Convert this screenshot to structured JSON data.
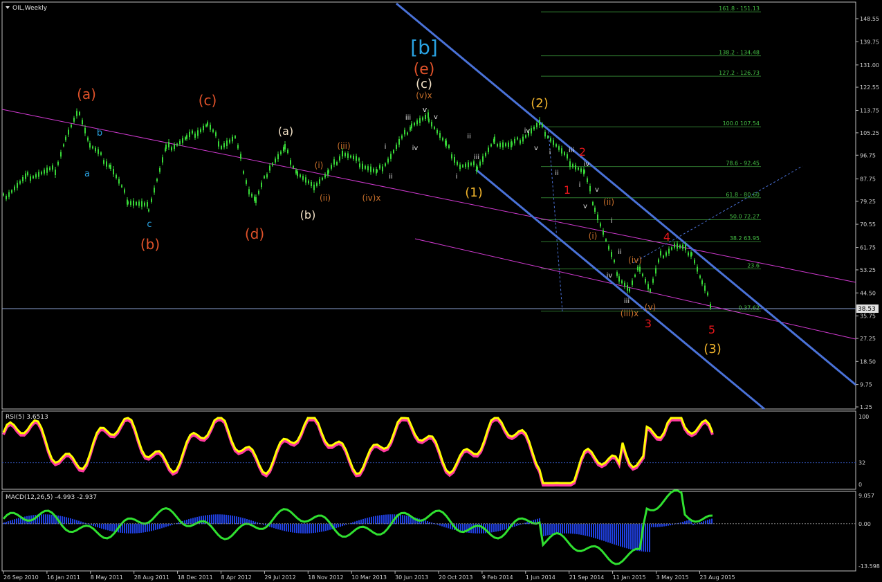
{
  "chart_data": [
    {
      "type": "candlestick",
      "title": "OIL,Weekly",
      "current_price": "38.53",
      "y_ticks": [
        "148.55",
        "139.75",
        "131.00",
        "122.55",
        "113.75",
        "105.25",
        "96.75",
        "87.75",
        "79.25",
        "70.55",
        "61.75",
        "53.25",
        "44.50",
        "35.75",
        "27.25",
        "18.50",
        "9.75",
        "1.25"
      ],
      "x_ticks": [
        "26 Sep 2010",
        "16 Jan 2011",
        "8 May 2011",
        "28 Aug 2011",
        "18 Dec 2011",
        "8 Apr 2012",
        "29 Jul 2012",
        "18 Nov 2012",
        "10 Mar 2013",
        "30 Jun 2013",
        "20 Oct 2013",
        "9 Feb 2014",
        "1 Jun 2014",
        "21 Sep 2014",
        "11 Jan 2015",
        "3 May 2015",
        "23 Aug 2015"
      ],
      "fib_levels": [
        {
          "label": "161.8 - 151.13",
          "value": 151.13
        },
        {
          "label": "138.2 - 134.48",
          "value": 134.48
        },
        {
          "label": "127.2 - 126.73",
          "value": 126.73
        },
        {
          "label": "100.0 107.54",
          "value": 107.54
        },
        {
          "label": "78.6 - 92.45",
          "value": 92.45
        },
        {
          "label": "61.8 - 80.60",
          "value": 80.6
        },
        {
          "label": "50.0 72.27",
          "value": 72.27
        },
        {
          "label": "38.2 63.95",
          "value": 63.95
        },
        {
          "label": "23.6",
          "value": 53.6
        },
        {
          "label": "0.37.62",
          "value": 37.62
        }
      ],
      "waves": [
        {
          "text": "[b]",
          "color": "#29a3e3",
          "size": 28
        },
        {
          "text": "(e)",
          "color": "#e0522a",
          "size": 22
        },
        {
          "text": "(c)",
          "color": "#f3e2c7",
          "size": 18
        },
        {
          "text": "(v)x",
          "color": "#c8702b",
          "size": 12
        },
        {
          "text": "v",
          "color": "#e0e0e0",
          "size": 11
        },
        {
          "text": "(a)",
          "color": "#e0522a",
          "size": 20
        },
        {
          "text": "(b)",
          "color": "#e0522a",
          "size": 20
        },
        {
          "text": "(c)",
          "color": "#e0522a",
          "size": 20
        },
        {
          "text": "(d)",
          "color": "#e0522a",
          "size": 20
        },
        {
          "text": "(a)",
          "color": "#f3e2c7",
          "size": 16
        },
        {
          "text": "(b)",
          "color": "#f3e2c7",
          "size": 16
        },
        {
          "text": "(1)",
          "color": "#f2b52c",
          "size": 18
        },
        {
          "text": "(2)",
          "color": "#f2b52c",
          "size": 18
        },
        {
          "text": "(3)",
          "color": "#f2b52c",
          "size": 18
        },
        {
          "text": "1",
          "color": "#e4161b",
          "size": 16
        },
        {
          "text": "2",
          "color": "#e4161b",
          "size": 16
        },
        {
          "text": "3",
          "color": "#e4161b",
          "size": 16
        },
        {
          "text": "4",
          "color": "#e4161b",
          "size": 16
        },
        {
          "text": "5",
          "color": "#e4161b",
          "size": 16
        },
        {
          "text": "(i)",
          "color": "#c8702b",
          "size": 12
        },
        {
          "text": "(ii)",
          "color": "#c8702b",
          "size": 12
        },
        {
          "text": "(iii)",
          "color": "#c8702b",
          "size": 12
        },
        {
          "text": "(iv)x",
          "color": "#c8702b",
          "size": 12
        },
        {
          "text": "(i)",
          "color": "#c8702b",
          "size": 12
        },
        {
          "text": "(ii)",
          "color": "#c8702b",
          "size": 12
        },
        {
          "text": "(iv)",
          "color": "#c8702b",
          "size": 12
        },
        {
          "text": "(v)",
          "color": "#c8702b",
          "size": 12
        },
        {
          "text": "(iii)x",
          "color": "#c8702b",
          "size": 12
        },
        {
          "text": "a",
          "color": "#29a3e3",
          "size": 13
        },
        {
          "text": "b",
          "color": "#29a3e3",
          "size": 13
        },
        {
          "text": "c",
          "color": "#29a3e3",
          "size": 13
        }
      ],
      "wave_small": [
        "i",
        "ii",
        "iii",
        "iv",
        "v"
      ]
    },
    {
      "type": "line",
      "title": "RSI(5) 3.6513",
      "y_ticks": [
        "100",
        "32",
        "0"
      ]
    },
    {
      "type": "bar",
      "title": "MACD(12,26,5) -4.993 -2.937",
      "y_ticks": [
        "9.057",
        "0.00",
        "-13.598"
      ]
    }
  ]
}
